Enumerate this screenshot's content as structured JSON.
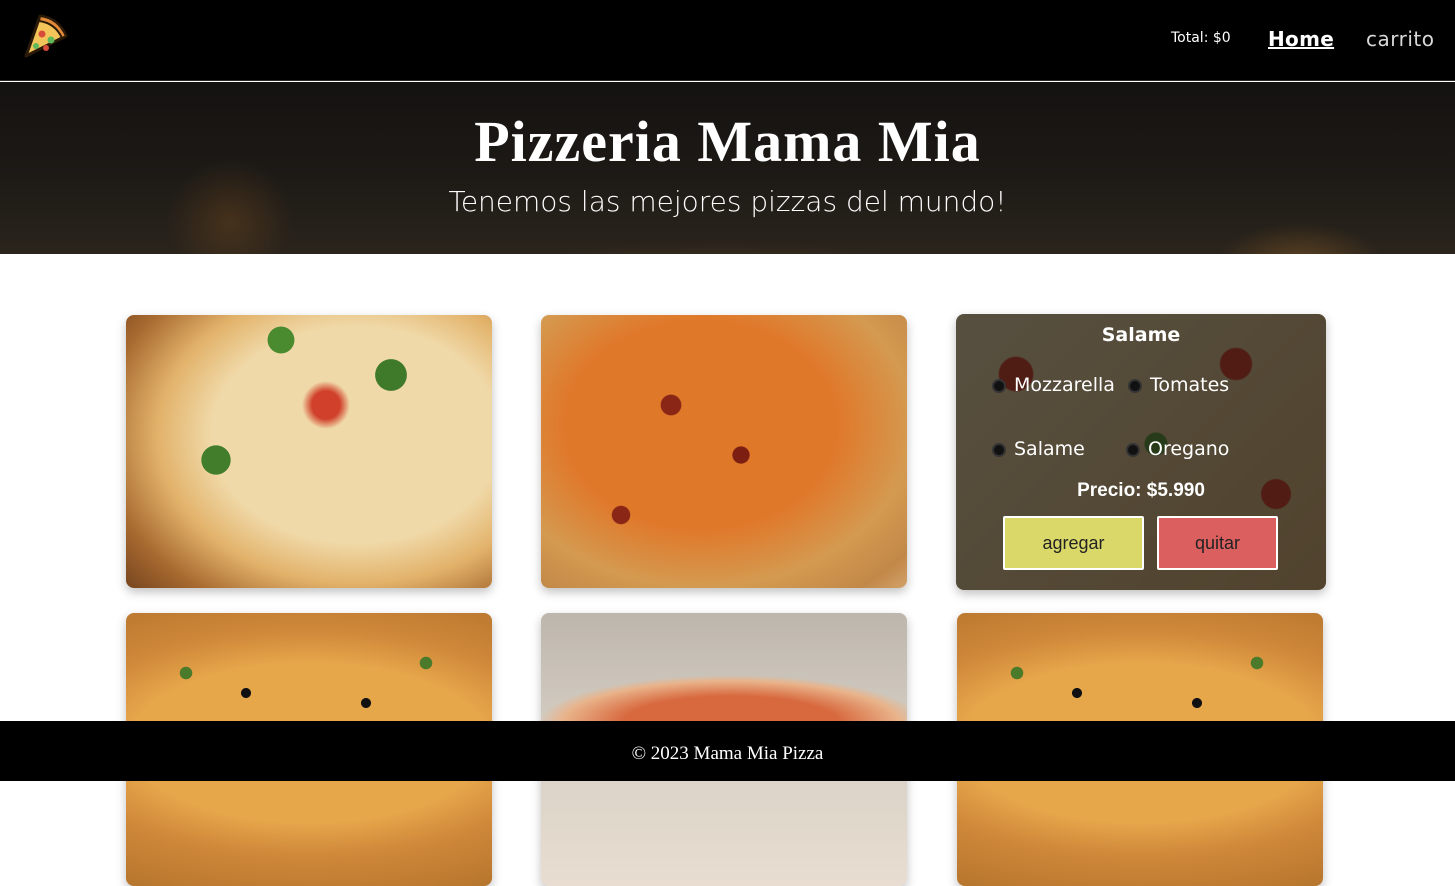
{
  "navbar": {
    "logo_icon": "pizza-slice-icon",
    "total_label": "Total: $0",
    "home_link": "Home",
    "cart_link": "carrito"
  },
  "hero": {
    "title": "Pizzeria Mama Mia",
    "subtitle": "Tenemos las mejores pizzas del mundo!"
  },
  "featured": {
    "name": "Salame",
    "ingredients": [
      "Mozzarella",
      "Tomates",
      "Salame",
      "Oregano"
    ],
    "price_label": "Precio: $5.990",
    "add_button": "agregar",
    "remove_button": "quitar"
  },
  "colors": {
    "add_button": "#dbd86a",
    "remove_button": "#dc5f5f",
    "navbar": "#000000"
  },
  "footer": {
    "text": "© 2023 Mama Mia Pizza"
  }
}
